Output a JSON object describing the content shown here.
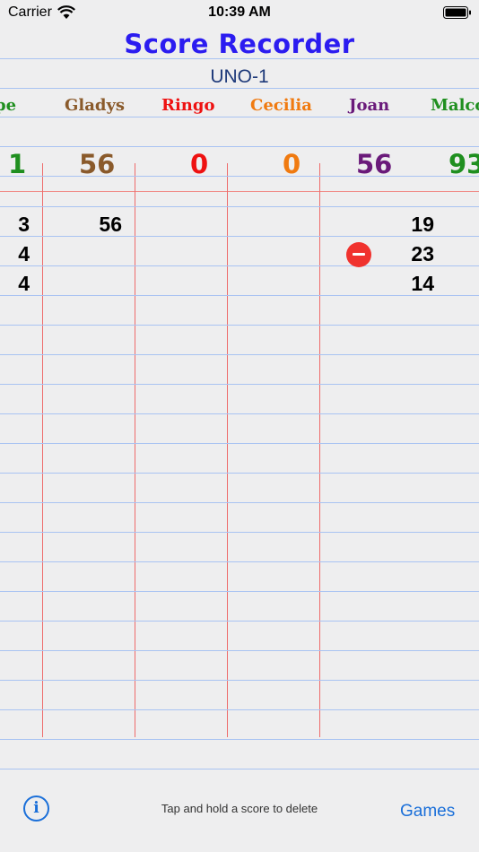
{
  "status_bar": {
    "carrier": "Carrier",
    "time": "10:39 AM"
  },
  "title": "Score Recorder",
  "game_name": "UNO-1",
  "players": [
    {
      "name": "pe",
      "total": "1",
      "color": "#1f8f1f"
    },
    {
      "name": "Gladys",
      "total": "56",
      "color": "#8a5a2b"
    },
    {
      "name": "Ringo",
      "total": "0",
      "color": "#ee1111"
    },
    {
      "name": "Cecilia",
      "total": "0",
      "color": "#f07a10"
    },
    {
      "name": "Joan",
      "total": "56",
      "color": "#6a1a7a"
    },
    {
      "name": "Malcol",
      "total": "93",
      "color": "#1f8f1f"
    }
  ],
  "scores": {
    "col0": [
      "3",
      "4",
      "4"
    ],
    "col1": [
      "56"
    ],
    "col5": [
      "19",
      "23",
      "14"
    ]
  },
  "footer": {
    "info_label": "i",
    "hint": "Tap and hold a score to delete",
    "games_label": "Games"
  }
}
